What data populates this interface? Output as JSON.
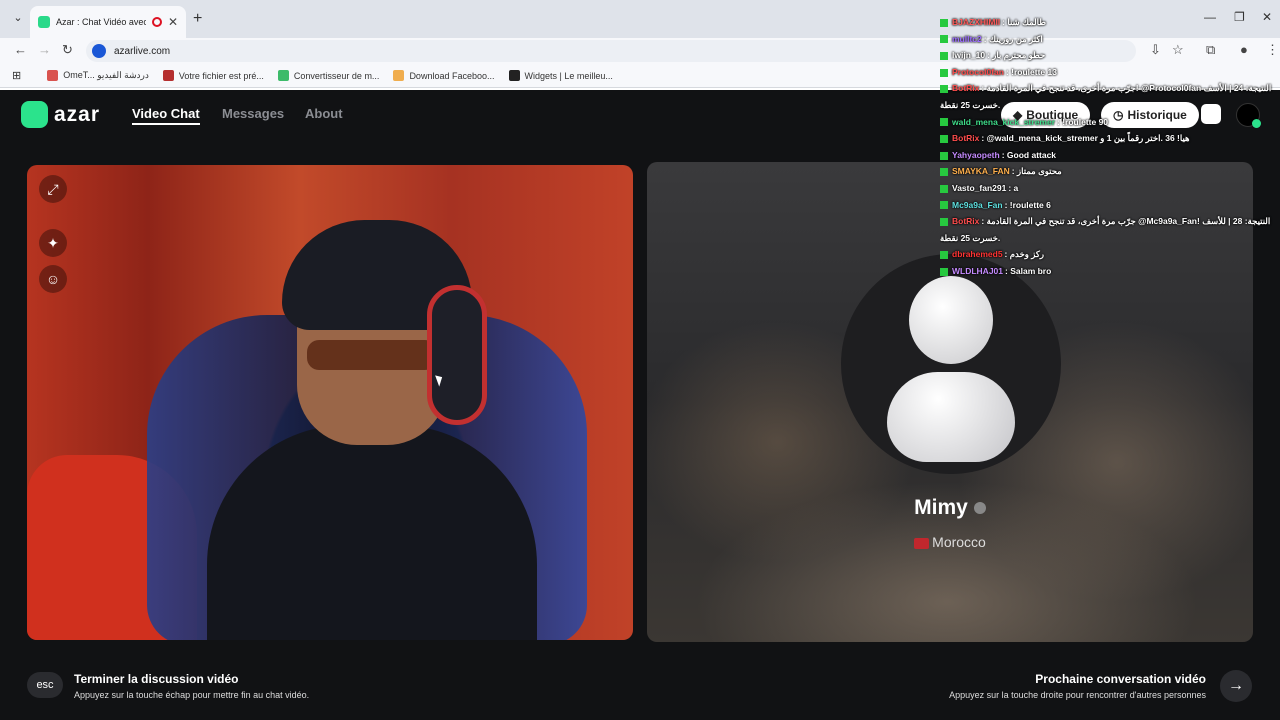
{
  "browser": {
    "tab_title": "Azar : Chat Vidéo avec de n",
    "url": "azarlive.com",
    "bookmarks": [
      {
        "label": "OmeT... دردشة الفيديو",
        "color": "#d9534f"
      },
      {
        "label": "Votre fichier est pré...",
        "color": "#b52f2f"
      },
      {
        "label": "Convertisseur de m...",
        "color": "#3dbb6a"
      },
      {
        "label": "Download Faceboo...",
        "color": "#f0ad4e"
      },
      {
        "label": "Widgets | Le meilleu...",
        "color": "#222222"
      }
    ]
  },
  "header": {
    "logo_text": "azar",
    "nav": [
      {
        "label": "Video Chat",
        "active": true
      },
      {
        "label": "Messages",
        "active": false
      },
      {
        "label": "About",
        "active": false
      }
    ],
    "boutique_label": "Boutique",
    "historique_label": "Historique"
  },
  "partner": {
    "name": "Mimy",
    "country": "Morocco"
  },
  "footer": {
    "esc_key": "esc",
    "end_title": "Terminer la discussion vidéo",
    "end_sub": "Appuyez sur la touche échap pour mettre fin au chat vidéo.",
    "next_title": "Prochaine conversation vidéo",
    "next_sub": "Appuyez sur la touche droite pour rencontrer d'autres personnes"
  },
  "chat": [
    {
      "user": "BJAZXHIMII",
      "text": ": طالمك شنا",
      "color": "#ff5a5a"
    },
    {
      "user": "mulltc2",
      "text": ": اكثر من رورينك",
      "color": "#9b6bff"
    },
    {
      "user": "lwijn_10",
      "text": ": حطو محترم بار",
      "color": "#ffffff"
    },
    {
      "user": "Protocol0fan",
      "text": ": !roulette 13",
      "color": "#ff4d4d"
    },
    {
      "user": "BotRix",
      "text": ": جرّب مرة أخرى، قد تنجح في المرة القادمة! @Protocol0fan النتيجة: 24 | الأسف",
      "color": "#ff4d4d"
    },
    {
      "user": "",
      "text": "خسرت 25 نقطة.",
      "color": "#ffffff"
    },
    {
      "user": "wald_mena_kick_stremer",
      "text": ": !roulette 90",
      "color": "#3fdc8a"
    },
    {
      "user": "BotRix",
      "text": ": @wald_mena_kick_stremer هيا! 36 .اختر رقماً بين 1 و",
      "color": "#ff4d4d"
    },
    {
      "user": "Yahyaopeth",
      "text": ": Good attack",
      "color": "#c58bff"
    },
    {
      "user": "SMAYKA_FAN",
      "text": ": محتوى ممتاز",
      "color": "#ffb04d"
    },
    {
      "user": "Vasto_fan291",
      "text": ": a",
      "color": "#ffffff"
    },
    {
      "user": "Mc9a9a_Fan",
      "text": ": !roulette 6",
      "color": "#5ee0e0"
    },
    {
      "user": "BotRix",
      "text": ": جرّب مرة أخرى، قد تنجح في المرة القادمة @Mc9a9a_Fan! النتيجة: 28 | للأسف",
      "color": "#ff4d4d"
    },
    {
      "user": "",
      "text": "خسرت 25 نقطة.",
      "color": "#ffffff"
    },
    {
      "user": "dbrahemed5",
      "text": ": ركز وخدم",
      "color": "#ff3333"
    },
    {
      "user": "WLDLHAJ01",
      "text": ": Salam bro",
      "color": "#c58bff"
    }
  ]
}
